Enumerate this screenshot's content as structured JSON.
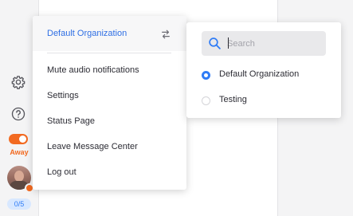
{
  "rail": {
    "settings_icon": "gear-icon",
    "help_icon": "help-circle-icon",
    "status": {
      "label": "Away",
      "toggle_on": true,
      "color": "#f26a21"
    },
    "avatar_status_color": "#f26a21",
    "chat_count": "0/5"
  },
  "menu": {
    "organization": {
      "label": "Default Organization",
      "switch_icon": "switch-arrows-icon"
    },
    "items": [
      {
        "label": "Mute audio notifications"
      },
      {
        "label": "Settings"
      },
      {
        "label": "Status Page"
      },
      {
        "label": "Leave Message Center"
      },
      {
        "label": "Log out"
      }
    ]
  },
  "org_switcher": {
    "search": {
      "placeholder": "Search",
      "value": ""
    },
    "organizations": [
      {
        "label": "Default Organization",
        "selected": true
      },
      {
        "label": "Testing",
        "selected": false
      }
    ]
  },
  "colors": {
    "accent": "#2f7cf6",
    "link": "#2f6fe4",
    "away": "#f26a21"
  }
}
